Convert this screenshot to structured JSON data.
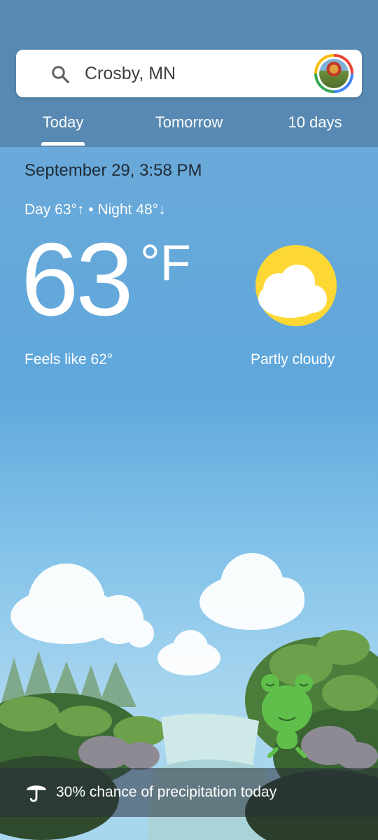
{
  "search": {
    "location": "Crosby, MN"
  },
  "tabs": [
    {
      "label": "Today",
      "selected": true
    },
    {
      "label": "Tomorrow",
      "selected": false
    },
    {
      "label": "10 days",
      "selected": false
    }
  ],
  "current": {
    "datetime": "September 29, 3:58 PM",
    "day_night": "Day 63°↑ • Night 48°↓",
    "temperature": "63",
    "unit": "°F",
    "feels_like": "Feels like 62°",
    "condition": "Partly cloudy",
    "condition_icon": "partly-cloudy-icon"
  },
  "precipitation": {
    "icon": "umbrella-icon",
    "text": "30% chance of precipitation today"
  },
  "colors": {
    "header": "#5889b2",
    "sky": "#6aa9d9",
    "sun": "#fdd835"
  }
}
